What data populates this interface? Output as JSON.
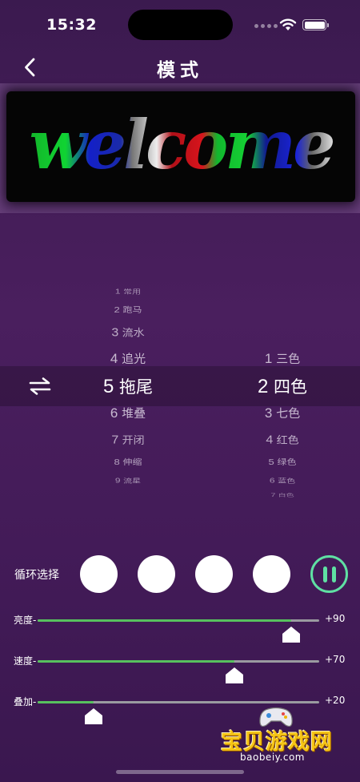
{
  "status_bar": {
    "time": "15:32"
  },
  "nav": {
    "title": "模式"
  },
  "preview": {
    "text": "welcome"
  },
  "picker": {
    "modes": [
      {
        "num": "1",
        "label": "常用"
      },
      {
        "num": "2",
        "label": "跑马"
      },
      {
        "num": "3",
        "label": "流水"
      },
      {
        "num": "4",
        "label": "追光"
      },
      {
        "num": "5",
        "label": "拖尾"
      },
      {
        "num": "6",
        "label": "堆叠"
      },
      {
        "num": "7",
        "label": "开闭"
      },
      {
        "num": "8",
        "label": "伸缩"
      },
      {
        "num": "9",
        "label": "流星"
      }
    ],
    "colors": [
      {
        "num": "1",
        "label": "三色"
      },
      {
        "num": "2",
        "label": "四色"
      },
      {
        "num": "3",
        "label": "七色"
      },
      {
        "num": "4",
        "label": "红色"
      },
      {
        "num": "5",
        "label": "绿色"
      },
      {
        "num": "6",
        "label": "蓝色"
      },
      {
        "num": "7",
        "label": "白色"
      }
    ],
    "selected_mode": "5",
    "selected_color": "2"
  },
  "cycle": {
    "label": "循环选择",
    "slots": 4
  },
  "sliders": [
    {
      "label": "亮度-",
      "value_label": "+90",
      "fraction": 0.9
    },
    {
      "label": "速度-",
      "value_label": "+70",
      "fraction": 0.7
    },
    {
      "label": "叠加-",
      "value_label": "+20",
      "fraction": 0.2
    }
  ],
  "watermark": {
    "title": "宝贝游戏网",
    "url": "baobeiy.com"
  },
  "colors": {
    "accent_green": "#5fe0a3",
    "slider_green": "#57c15e",
    "background": "#4a1f5e",
    "watermark_yellow": "#f6c515"
  }
}
